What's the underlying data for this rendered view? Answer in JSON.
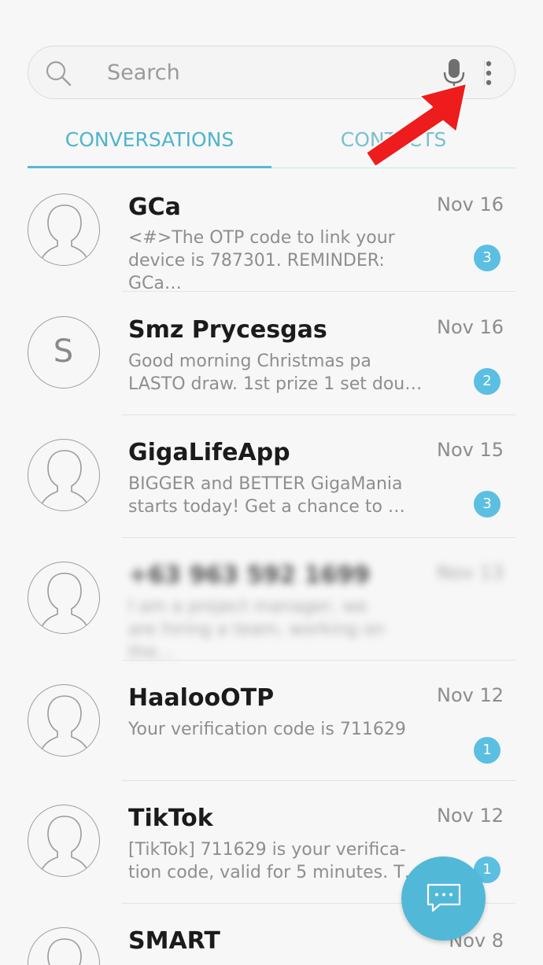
{
  "search": {
    "placeholder": "Search",
    "icons": {
      "search": "search-icon",
      "mic": "microphone-icon",
      "more": "more-vertical-icon"
    }
  },
  "tabs": [
    {
      "label": "CONVERSATIONS",
      "selected": true
    },
    {
      "label": "CONTACTS",
      "selected": false
    }
  ],
  "colors": {
    "accent": "#4fb4cc",
    "badge": "#5bbfe2",
    "fab": "#52b8d8",
    "annotation_arrow": "#ee1c1c"
  },
  "conversations": [
    {
      "name": "GCa",
      "date": "Nov 16",
      "preview_line1": "<#>The OTP code to link your",
      "preview_line2": "device is 787301. REMINDER: GCa…",
      "unread": "3",
      "avatar": "person-silhouette-icon"
    },
    {
      "name": "Smz Prycesgas",
      "date": "Nov 16",
      "preview_line1": "Good morning Christmas pa",
      "preview_line2": "LASTO draw. 1st prize 1 set dou…",
      "unread": "2",
      "avatar_letter": "S"
    },
    {
      "name": "GigaLifeApp",
      "date": "Nov 15",
      "preview_line1": "BIGGER and BETTER GigaMania",
      "preview_line2": "starts today!   Get a chance to …",
      "unread": "3",
      "avatar": "person-silhouette-icon"
    },
    {
      "name": "+63 963 592 1699",
      "date": "Nov 13",
      "preview_line1": "I am a project manager, we",
      "preview_line2": "are hiring a team, working on the…",
      "blurred": true,
      "avatar": "person-silhouette-icon"
    },
    {
      "name": "HaalooOTP",
      "date": "Nov 12",
      "preview_line1": "Your verification code is 711629",
      "preview_line2": "",
      "unread": "1",
      "avatar": "person-silhouette-icon"
    },
    {
      "name": "TikTok",
      "date": "Nov 12",
      "preview_line1": "[TikTok] 711629 is your verifica-",
      "preview_line2": "tion code, valid for 5 minutes. T…",
      "unread": "1",
      "avatar": "person-silhouette-icon"
    },
    {
      "name": "SMART",
      "date": "Nov 8",
      "avatar": "person-silhouette-icon"
    }
  ],
  "fab": {
    "icon": "compose-message-icon"
  }
}
